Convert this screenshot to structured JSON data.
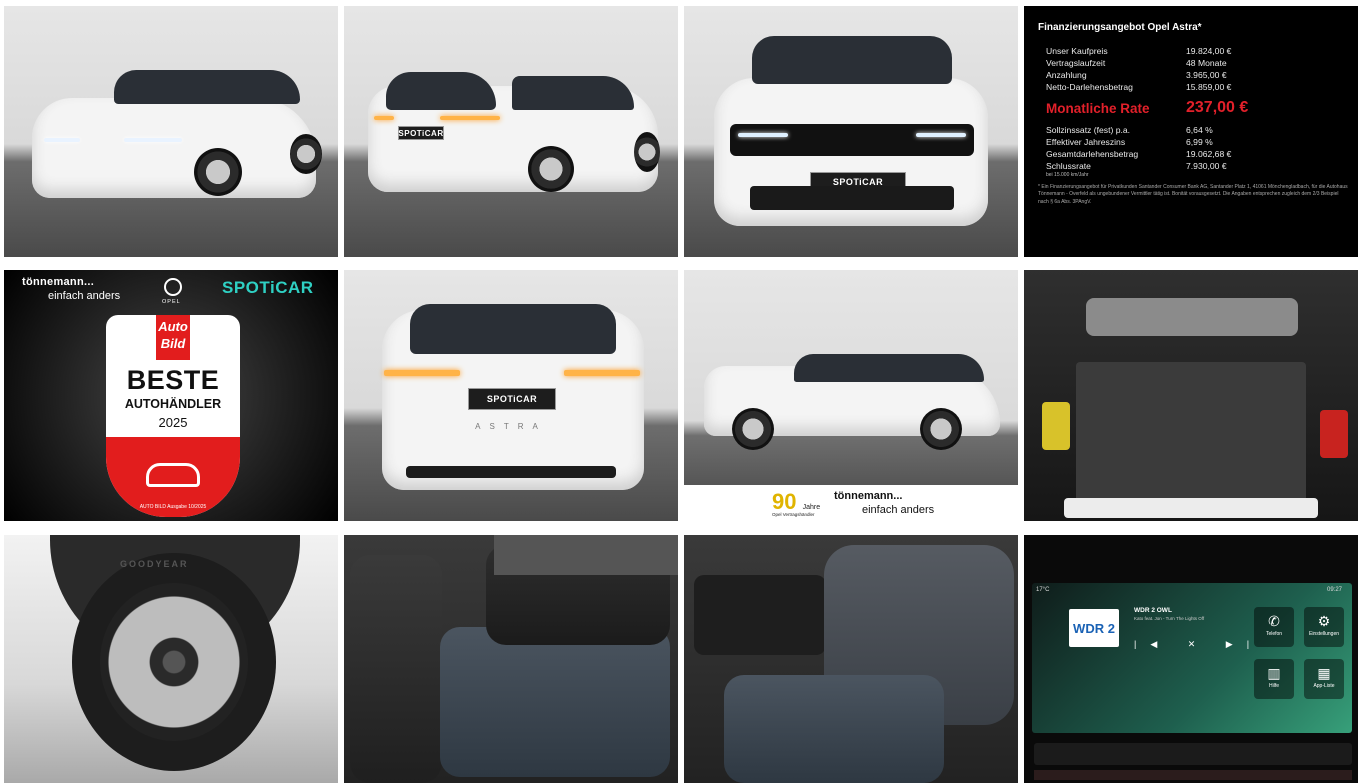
{
  "financing": {
    "title": "Finanzierungsangebot Opel Astra*",
    "rows_top": [
      {
        "label": "Unser Kaufpreis",
        "value": "19.824,00 €"
      },
      {
        "label": "Vertragslaufzeit",
        "value": "48 Monate"
      },
      {
        "label": "Anzahlung",
        "value": "3.965,00 €"
      },
      {
        "label": "Netto-Darlehensbetrag",
        "value": "15.859,00 €"
      }
    ],
    "rate_label": "Monatliche Rate",
    "rate_value": "237,00 €",
    "rows_bottom": [
      {
        "label": "Sollzinssatz (fest) p.a.",
        "value": "6,64 %"
      },
      {
        "label": "Effektiver Jahreszins",
        "value": "6,99 %"
      },
      {
        "label": "Gesamtdarlehensbetrag",
        "value": "19.062,68 €"
      },
      {
        "label": "Schlussrate",
        "value": "7.930,00 €"
      }
    ],
    "km_note": "bei 15.000 km/Jahr",
    "footnote": "* Ein Finanzierungsangebot für Privatkunden Santander Consumer Bank AG, Santander Platz 1, 41061 Mönchengladbach, für die Autohaus Tönnemann - Overfeld als ungebundener Vermittler tätig ist. Bonität vorausgesetzt. Die Angaben entsprechen zugleich dem 2/3 Beispiel nach § 6a Abs. 3PAngV."
  },
  "award": {
    "dealer_name": "tönnemann...",
    "dealer_slogan": "einfach anders",
    "opel_label": "OPEL",
    "spoticar": "SPOTiCAR",
    "autobild": "Auto Bild",
    "beste": "BESTE",
    "autohaendler": "AUTOHÄNDLER",
    "year": "2025",
    "issue": "AUTO BILD Ausgabe 10/2025"
  },
  "plates": {
    "front": "SPOTiCAR",
    "rear": "SPOTiCAR"
  },
  "rear_badge": "ASTRA",
  "side_banner": {
    "jahre_number": "90",
    "jahre_word": "Jahre",
    "jahre_sub": "Opel Vertragshändler",
    "dealer_name": "tönnemann...",
    "dealer_slogan": "einfach anders"
  },
  "tire_brand": "GOODYEAR",
  "infotainment": {
    "temp": "17°C",
    "time": "09:27",
    "logo": "WDR 2",
    "station": "WDR 2 OWL",
    "track": "Kato feat. Jon - Turn The Lights Off",
    "buttons": [
      {
        "label": "Telefon",
        "icon": "phone-icon"
      },
      {
        "label": "Einstellungen",
        "icon": "gear-icon"
      },
      {
        "label": "Hilfe",
        "icon": "book-icon"
      },
      {
        "label": "App-Liste",
        "icon": "grid-icon"
      }
    ]
  }
}
